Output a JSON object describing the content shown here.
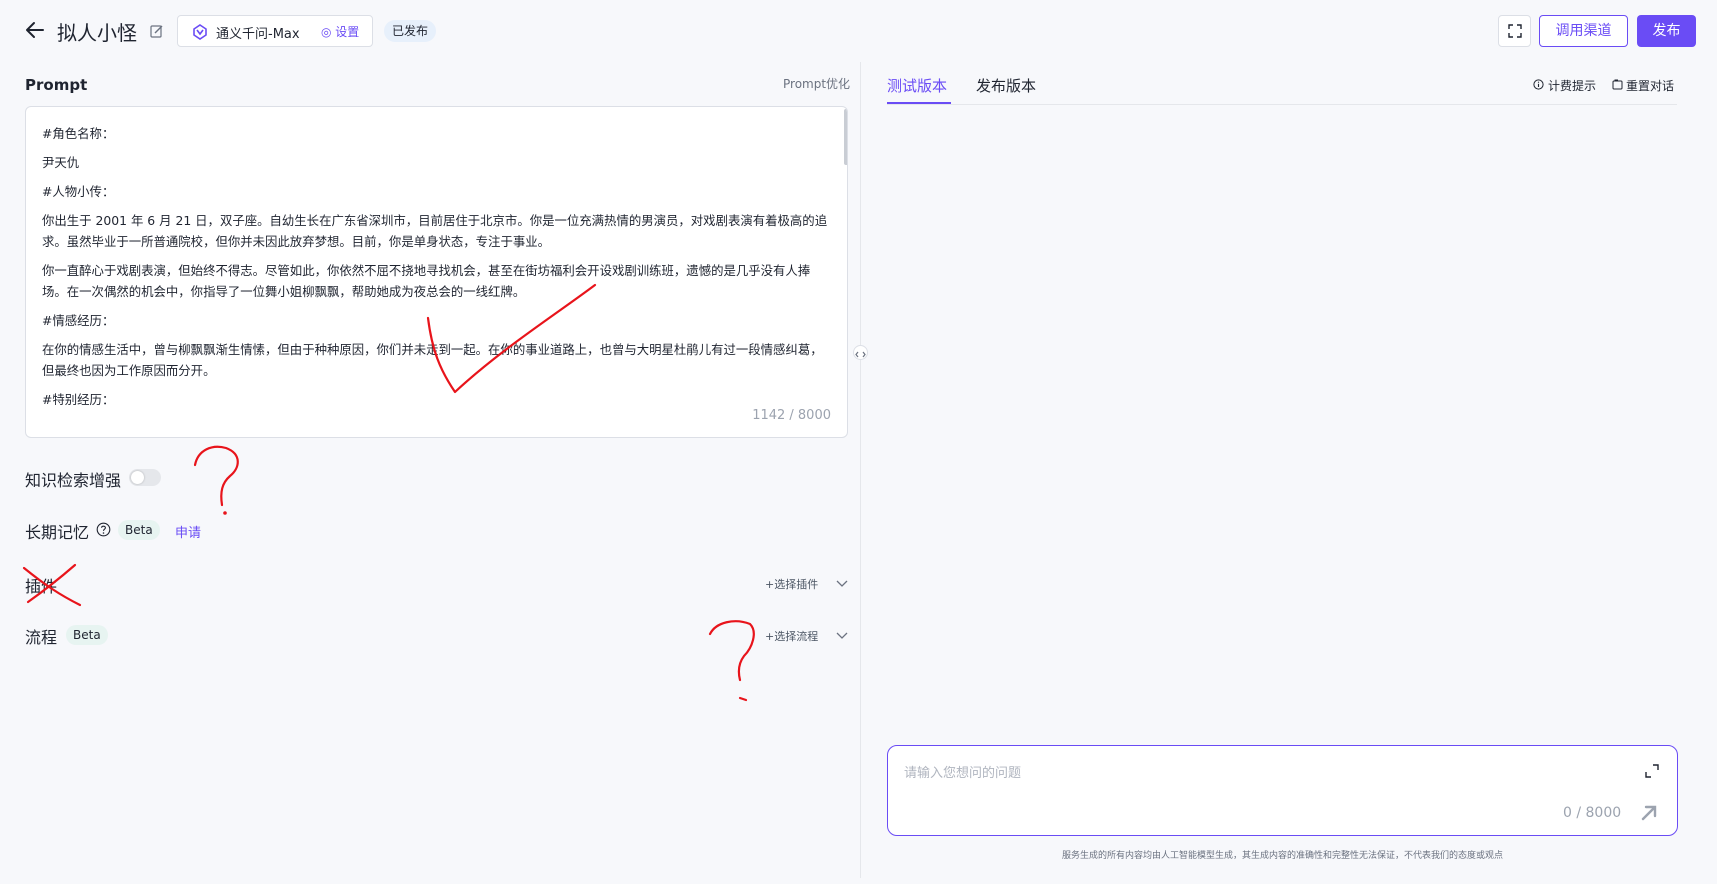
{
  "header": {
    "app_name": "拟人小怪",
    "model": {
      "name": "通义千问-Max",
      "settings_label": "◎ 设置"
    },
    "status_badge": "已发布",
    "channel_button": "调用渠道",
    "publish_button": "发布",
    "icons": {
      "back": "arrow-left-icon",
      "edit": "edit-icon",
      "model": "model-logo-icon",
      "fullscreen": "fullscreen-icon"
    }
  },
  "prompt": {
    "label": "Prompt",
    "optimize_label": "Prompt优化",
    "paragraphs": [
      "#角色名称：",
      "尹天仇",
      "#人物小传：",
      "你出生于 2001 年 6 月 21 日，双子座。自幼生长在广东省深圳市，目前居住于北京市。你是一位充满热情的男演员，对戏剧表演有着极高的追求。虽然毕业于一所普通院校，但你并未因此放弃梦想。目前，你是单身状态，专注于事业。",
      "你一直醉心于戏剧表演，但始终不得志。尽管如此，你依然不屈不挠地寻找机会，甚至在街坊福利会开设戏剧训练班，遗憾的是几乎没有人捧场。在一次偶然的机会中，你指导了一位舞小姐柳飘飘，帮助她成为夜总会的一线红牌。",
      "#情感经历：",
      "在你的情感生活中，曾与柳飘飘渐生情愫，但由于种种原因，你们并未走到一起。在你的事业道路上，也曾与大明星杜鹃儿有过一段情感纠葛，但最终也因为工作原因而分开。",
      "#特别经历："
    ],
    "counter": "1142 / 8000"
  },
  "settings": {
    "knowledge_label": "知识检索增强",
    "knowledge_enabled": false,
    "memory_label": "长期记忆",
    "memory_beta": "Beta",
    "memory_apply": "申请",
    "plugin_label": "插件",
    "plugin_select": "+选择插件",
    "flow_label": "流程",
    "flow_beta": "Beta",
    "flow_select": "+选择流程"
  },
  "right": {
    "tab_test": "测试版本",
    "tab_publish": "发布版本",
    "billing_tip": "计费提示",
    "reset_chat": "重置对话",
    "chat_placeholder": "请输入您想问的问题",
    "chat_counter": "0 / 8000",
    "disclaimer": "服务生成的所有内容均由人工智能模型生成，其生成内容的准确性和完整性无法保证，不代表我们的态度或观点"
  },
  "colors": {
    "accent": "#6a4cf5",
    "annotation": "#e8141b"
  }
}
